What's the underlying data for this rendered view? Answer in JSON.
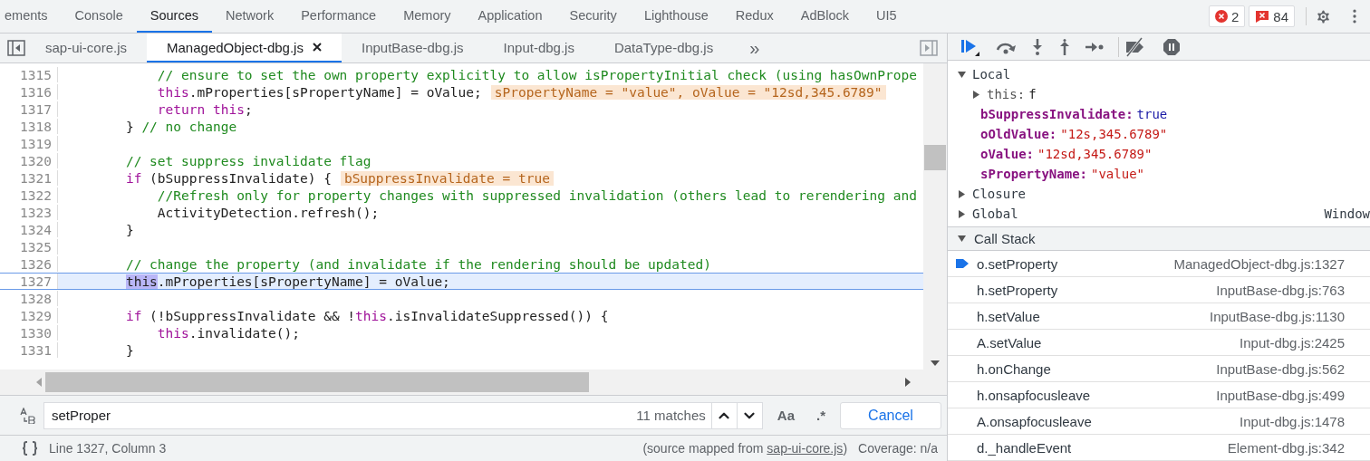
{
  "panel_tabs": [
    {
      "label": "ements",
      "selected": false
    },
    {
      "label": "Console",
      "selected": false
    },
    {
      "label": "Sources",
      "selected": true
    },
    {
      "label": "Network",
      "selected": false
    },
    {
      "label": "Performance",
      "selected": false
    },
    {
      "label": "Memory",
      "selected": false
    },
    {
      "label": "Application",
      "selected": false
    },
    {
      "label": "Security",
      "selected": false
    },
    {
      "label": "Lighthouse",
      "selected": false
    },
    {
      "label": "Redux",
      "selected": false
    },
    {
      "label": "AdBlock",
      "selected": false
    },
    {
      "label": "UI5",
      "selected": false
    }
  ],
  "counters": [
    {
      "kind": "error",
      "count": "2"
    },
    {
      "kind": "issue",
      "count": "84"
    }
  ],
  "file_tabs": [
    {
      "label": "sap-ui-core.js",
      "selected": false
    },
    {
      "label": "ManagedObject-dbg.js",
      "selected": true
    },
    {
      "label": "InputBase-dbg.js",
      "selected": false
    },
    {
      "label": "Input-dbg.js",
      "selected": false
    },
    {
      "label": "DataType-dbg.js",
      "selected": false
    }
  ],
  "more_tabs": "»",
  "code_lines": [
    {
      "number": "1315",
      "current": false,
      "tokens": [
        {
          "kind": "comment",
          "t": "        // ensure to set the own property explicitly to allow isPropertyInitial check (using hasOwnPrope"
        }
      ]
    },
    {
      "number": "1316",
      "current": false,
      "tokens": [
        {
          "kind": "keyword",
          "t": "        this"
        },
        {
          "kind": "plain",
          "t": ".mProperties[sPropertyName] = oValue;"
        }
      ],
      "inline_value": "sPropertyName = \"value\", oValue = \"12sd,345.6789\""
    },
    {
      "number": "1317",
      "current": false,
      "tokens": [
        {
          "kind": "keyword",
          "t": "        return this"
        },
        {
          "kind": "plain",
          "t": ";"
        }
      ]
    },
    {
      "number": "1318",
      "current": false,
      "tokens": [
        {
          "kind": "plain",
          "t": "    } "
        },
        {
          "kind": "comment",
          "t": "// no change"
        }
      ]
    },
    {
      "number": "1319",
      "current": false
    },
    {
      "number": "1320",
      "current": false,
      "tokens": [
        {
          "kind": "comment",
          "t": "    // set suppress invalidate flag"
        }
      ]
    },
    {
      "number": "1321",
      "current": false,
      "tokens": [
        {
          "kind": "keyword",
          "t": "    if"
        },
        {
          "kind": "plain",
          "t": " (bSuppressInvalidate) {"
        }
      ],
      "inline_value": "bSuppressInvalidate = true"
    },
    {
      "number": "1322",
      "current": false,
      "tokens": [
        {
          "kind": "comment",
          "t": "        //Refresh only for property changes with suppressed invalidation (others lead to rerendering and"
        }
      ]
    },
    {
      "number": "1323",
      "current": false,
      "tokens": [
        {
          "kind": "plain",
          "t": "        ActivityDetection.refresh();"
        }
      ]
    },
    {
      "number": "1324",
      "current": false,
      "tokens": [
        {
          "kind": "plain",
          "t": "    }"
        }
      ]
    },
    {
      "number": "1325",
      "current": false
    },
    {
      "number": "1326",
      "current": false,
      "tokens": [
        {
          "kind": "comment",
          "t": "    // change the property (and invalidate if the rendering should be updated)"
        }
      ]
    },
    {
      "number": "1327",
      "current": true,
      "tokens": [
        {
          "kind": "match",
          "t": "    this"
        },
        {
          "kind": "plain",
          "t": ".mProperties[sPropertyName] = oValue;"
        }
      ]
    },
    {
      "number": "1328",
      "current": false
    },
    {
      "number": "1329",
      "current": false,
      "tokens": [
        {
          "kind": "keyword",
          "t": "    if"
        },
        {
          "kind": "plain",
          "t": " (!bSuppressInvalidate && !"
        },
        {
          "kind": "keyword",
          "t": "this"
        },
        {
          "kind": "plain",
          "t": ".isInvalidateSuppressed()) {"
        }
      ]
    },
    {
      "number": "1330",
      "current": false,
      "tokens": [
        {
          "kind": "keyword",
          "t": "        this"
        },
        {
          "kind": "plain",
          "t": ".invalidate();"
        }
      ]
    },
    {
      "number": "1331",
      "current": false,
      "tokens": [
        {
          "kind": "plain",
          "t": "    }"
        }
      ]
    }
  ],
  "search": {
    "value": "setProper",
    "matches": "11 matches",
    "case_label": "Aa",
    "regex_label": ".*",
    "cancel": "Cancel"
  },
  "status": {
    "position": "Line 1327, Column 3",
    "mapped_prefix": "(source mapped from ",
    "mapped_link": "sap-ui-core.js",
    "mapped_suffix": ")",
    "coverage": "Coverage: n/a"
  },
  "scope": [
    {
      "name": "Local",
      "expanded": true,
      "children": [
        {
          "kind": "object",
          "name": "this:",
          "value": "f",
          "expanded": false
        },
        {
          "kind": "bool",
          "name": "bSuppressInvalidate:",
          "value": "true"
        },
        {
          "kind": "string",
          "name": "oOldValue:",
          "value": "\"12s,345.6789\""
        },
        {
          "kind": "string",
          "name": "oValue:",
          "value": "\"12sd,345.6789\""
        },
        {
          "kind": "string",
          "name": "sPropertyName:",
          "value": "\"value\""
        }
      ]
    },
    {
      "name": "Closure",
      "expanded": false
    },
    {
      "name": "Global",
      "expanded": false,
      "value": "Window"
    }
  ],
  "call_stack": {
    "title": "Call Stack",
    "expanded": true,
    "frames": [
      {
        "function": "o.setProperty",
        "location": "ManagedObject-dbg.js:1327",
        "selected": true
      },
      {
        "function": "h.setProperty",
        "location": "InputBase-dbg.js:763",
        "selected": false
      },
      {
        "function": "h.setValue",
        "location": "InputBase-dbg.js:1130",
        "selected": false
      },
      {
        "function": "A.setValue",
        "location": "Input-dbg.js:2425",
        "selected": false
      },
      {
        "function": "h.onChange",
        "location": "InputBase-dbg.js:562",
        "selected": false
      },
      {
        "function": "h.onsapfocusleave",
        "location": "InputBase-dbg.js:499",
        "selected": false
      },
      {
        "function": "A.onsapfocusleave",
        "location": "Input-dbg.js:1478",
        "selected": false
      },
      {
        "function": "d._handleEvent",
        "location": "Element-dbg.js:342",
        "selected": false
      }
    ]
  }
}
